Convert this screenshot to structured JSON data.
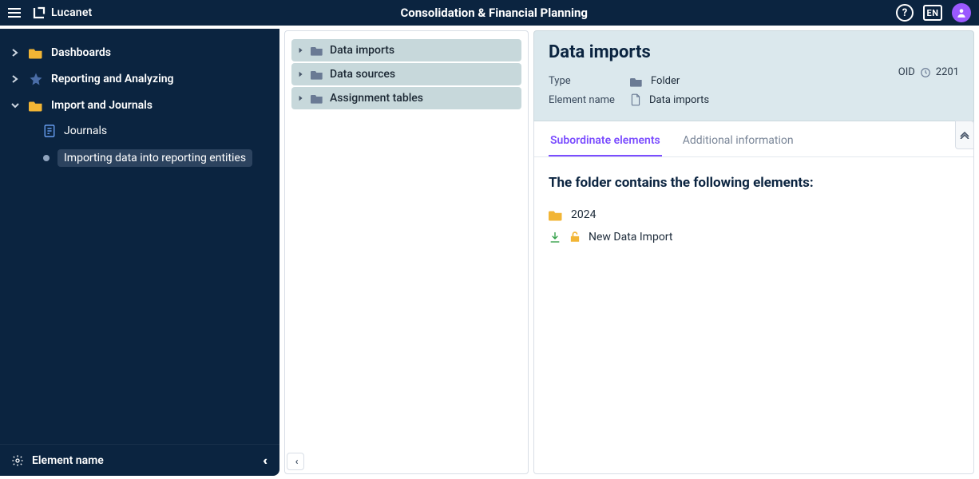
{
  "app": {
    "brand": "Lucanet",
    "title": "Consolidation & Financial Planning",
    "language": "EN"
  },
  "sidebar": {
    "items": [
      {
        "label": "Dashboards",
        "icon": "folder",
        "expanded": false
      },
      {
        "label": "Reporting and Analyzing",
        "icon": "star",
        "expanded": false
      },
      {
        "label": "Import and Journals",
        "icon": "folder",
        "expanded": true
      }
    ],
    "sub": {
      "journals": "Journals",
      "importing": "Importing data into reporting entities"
    },
    "footer": "Element name"
  },
  "tree": {
    "rows": [
      {
        "label": "Data imports"
      },
      {
        "label": "Data sources"
      },
      {
        "label": "Assignment tables"
      }
    ]
  },
  "details": {
    "heading": "Data imports",
    "meta": {
      "typeLabel": "Type",
      "typeValue": "Folder",
      "nameLabel": "Element name",
      "nameValue": "Data imports",
      "oidLabel": "OID",
      "oidValue": "2201"
    },
    "tabs": {
      "subordinate": "Subordinate elements",
      "additional": "Additional information"
    },
    "body": {
      "heading": "The folder contains the following elements:",
      "rows": [
        {
          "label": "2024"
        },
        {
          "label": "New Data Import"
        }
      ]
    }
  }
}
